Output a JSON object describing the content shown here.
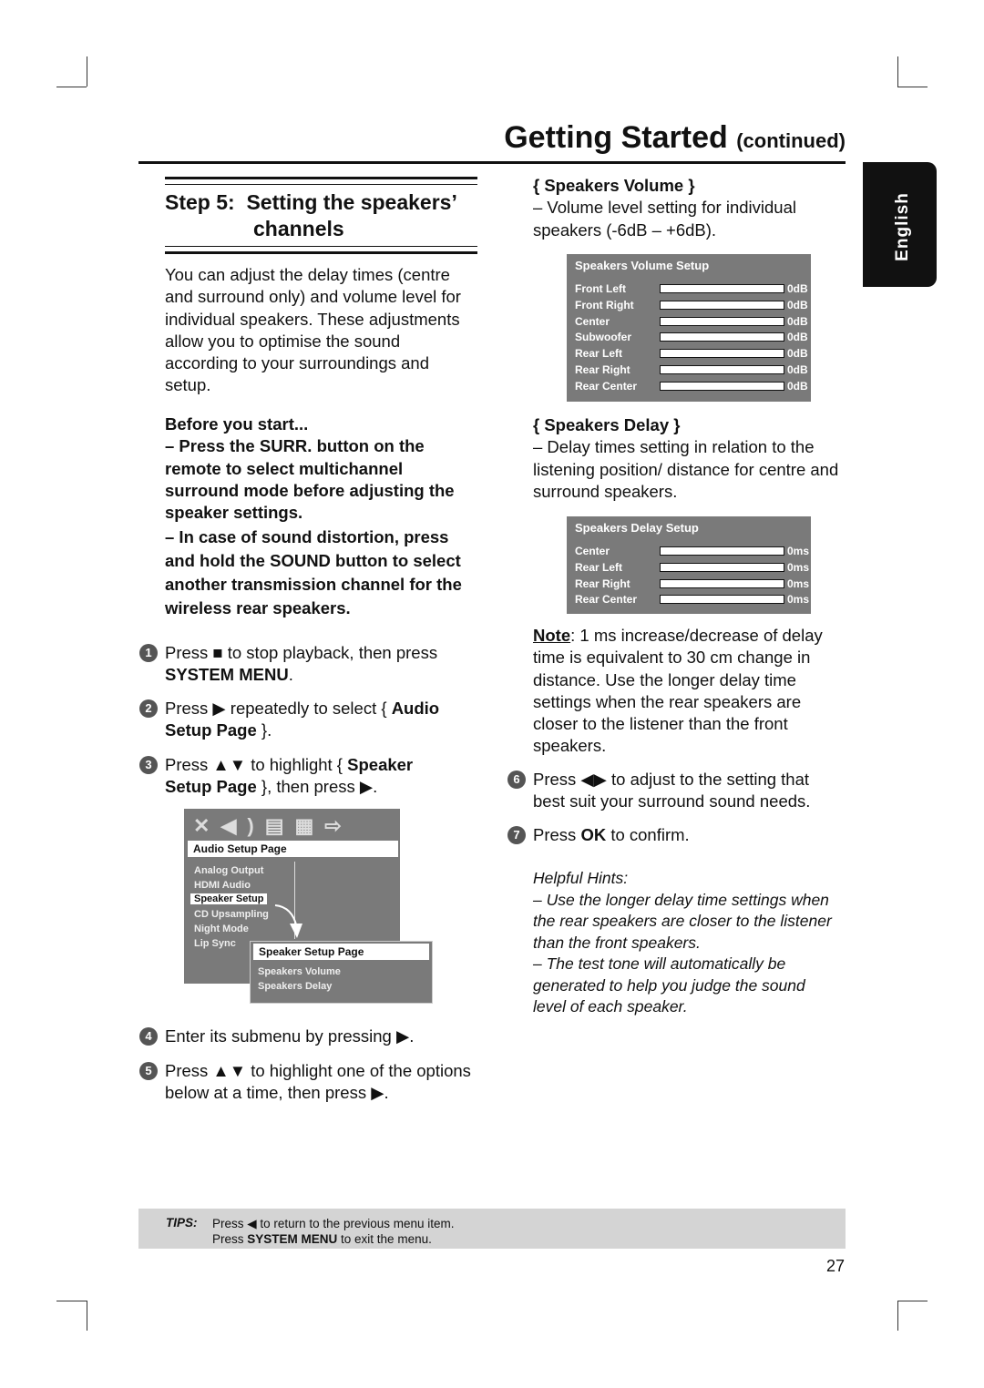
{
  "header": {
    "title": "Getting Started",
    "continued": "(continued)"
  },
  "language_tab": "English",
  "step": {
    "label": "Step 5:",
    "title_line1": "Setting the speakers’",
    "title_line2": "channels"
  },
  "intro": "You can adjust the delay times (centre and surround only) and volume level for individual speakers. These adjustments allow you to optimise the sound according to your surroundings and setup.",
  "before": {
    "heading": "Before you start...",
    "item1": "–  Press the SURR. button on the remote to select multichannel surround mode before adjusting the speaker settings.",
    "item2": "–  In case of sound distortion, press and hold the SOUND button to select another transmission channel for the wireless rear speakers."
  },
  "steps": [
    {
      "n": "1",
      "pre": "Press ■ to stop playback, then press ",
      "bold": "SYSTEM MENU",
      "post": "."
    },
    {
      "n": "2",
      "pre": "Press ▶ repeatedly to select { ",
      "bold": "Audio Setup Page",
      "post": " }."
    },
    {
      "n": "3",
      "pre": "Press ▲▼ to highlight { ",
      "bold": "Speaker Setup Page",
      "post": " }, then press ▶."
    },
    {
      "n": "4",
      "pre": "Enter its submenu by pressing ▶.",
      "bold": "",
      "post": ""
    },
    {
      "n": "5",
      "pre": "Press ▲▼ to highlight one of the options below at a time, then press ▶.",
      "bold": "",
      "post": ""
    },
    {
      "n": "6",
      "pre": "Press ◀▶ to adjust to the setting that best suit your surround sound needs.",
      "bold": "",
      "post": ""
    },
    {
      "n": "7",
      "pre": "Press ",
      "bold": "OK",
      "post": " to confirm."
    }
  ],
  "audio_menu": {
    "icons": [
      "tools-icon",
      "speaker-icon",
      "film-icon",
      "checkerboard-icon",
      "exit-icon"
    ],
    "title": "Audio Setup Page",
    "items": [
      "Analog Output",
      "HDMI Audio",
      "Speaker Setup",
      "CD Upsampling",
      "Night Mode",
      "Lip Sync"
    ],
    "selected": "Speaker Setup",
    "sub_title": "Speaker Setup Page",
    "sub_items": [
      "Speakers Volume",
      "Speakers Delay"
    ]
  },
  "volume": {
    "heading": "{ Speakers Volume }",
    "desc": "–  Volume level setting for individual speakers (-6dB – +6dB).",
    "osd_title": "Speakers Volume Setup",
    "rows": [
      {
        "label": "Front Left",
        "value": "0dB"
      },
      {
        "label": "Front Right",
        "value": "0dB"
      },
      {
        "label": "Center",
        "value": "0dB"
      },
      {
        "label": "Subwoofer",
        "value": "0dB"
      },
      {
        "label": "Rear Left",
        "value": "0dB"
      },
      {
        "label": "Rear Right",
        "value": "0dB"
      },
      {
        "label": "Rear Center",
        "value": "0dB"
      }
    ]
  },
  "delay": {
    "heading": "{ Speakers Delay }",
    "desc": "–  Delay times setting in relation to the listening position/ distance for centre and surround speakers.",
    "osd_title": "Speakers Delay Setup",
    "rows": [
      {
        "label": "Center",
        "value": "0ms"
      },
      {
        "label": "Rear Left",
        "value": "0ms"
      },
      {
        "label": "Rear Right",
        "value": "0ms"
      },
      {
        "label": "Rear Center",
        "value": "0ms"
      }
    ]
  },
  "note": {
    "label": "Note",
    "text": ": 1 ms increase/decrease of delay time is equivalent to 30 cm change in distance.  Use the longer delay time settings when the rear speakers are closer to the listener than the front speakers."
  },
  "hints": {
    "title": "Helpful Hints:",
    "hint1": "– Use the longer delay time settings when the rear speakers are closer to the listener than the front speakers.",
    "hint2": "– The test tone will automatically be generated to help you judge the sound level of each speaker."
  },
  "tips": {
    "label": "TIPS:",
    "line1": "Press ◀ to return to the previous menu item.",
    "line2_pre": "Press ",
    "line2_bold": "SYSTEM MENU",
    "line2_post": " to exit the menu."
  },
  "page_number": "27"
}
